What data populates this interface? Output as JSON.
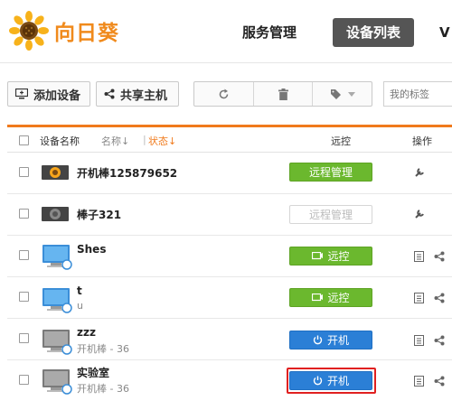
{
  "header": {
    "logo_text": "向日葵",
    "nav": {
      "service": "服务管理",
      "devices": "设备列表",
      "partial": "V"
    }
  },
  "toolbar": {
    "add_device": "添加设备",
    "share_host": "共享主机",
    "tag_placeholder": "我的标签"
  },
  "table": {
    "headers": {
      "device_name": "设备名称",
      "sort_name": "名称↓",
      "separator": "|",
      "sort_status": "状态↓",
      "remote": "远控",
      "ops": "操作"
    },
    "rows": [
      {
        "name": "开机棒125879652",
        "sub": "",
        "button": "远程管理",
        "button_style": "green",
        "device_type": "power-stick"
      },
      {
        "name": "棒子321",
        "sub": "",
        "button": "远程管理",
        "button_style": "disabled",
        "device_type": "power-stick"
      },
      {
        "name": "Shes",
        "sub": "",
        "button": "远控",
        "button_style": "green",
        "device_type": "computer-online"
      },
      {
        "name": "t",
        "sub": "u",
        "button": "远控",
        "button_style": "green",
        "device_type": "computer-online"
      },
      {
        "name": "zzz",
        "sub": "开机棒 - 36",
        "button": "开机",
        "button_style": "blue",
        "device_type": "computer-offline"
      },
      {
        "name": "实验室",
        "sub": "开机棒 - 36",
        "button": "开机",
        "button_style": "blue",
        "device_type": "computer-offline",
        "highlighted": true
      }
    ]
  },
  "colors": {
    "accent_orange": "#f07a1c",
    "green": "#6bb82e",
    "blue": "#2b7fd6",
    "highlight_red": "#e02020"
  }
}
